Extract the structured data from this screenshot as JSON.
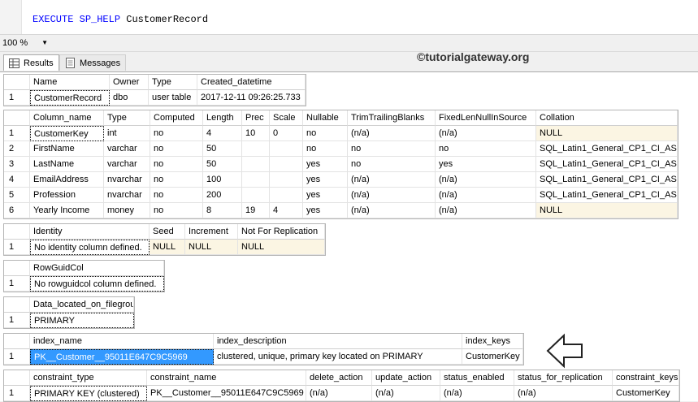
{
  "editor": {
    "kw1": "EXECUTE",
    "kw2": "SP_HELP",
    "table": "CustomerRecord"
  },
  "toolbar": {
    "zoom": "100 %"
  },
  "tabs": {
    "results": "Results",
    "messages": "Messages"
  },
  "watermark": "©tutorialgateway.org",
  "colors": {
    "keyword": "#0000ff",
    "selection": "#3399ff",
    "highlight": "#fbf5e3"
  },
  "grid1": {
    "headers": [
      "Name",
      "Owner",
      "Type",
      "Created_datetime"
    ],
    "rows": [
      [
        "1",
        "CustomerRecord",
        "dbo",
        "user table",
        "2017-12-11 09:26:25.733"
      ]
    ]
  },
  "grid2": {
    "headers": [
      "Column_name",
      "Type",
      "Computed",
      "Length",
      "Prec",
      "Scale",
      "Nullable",
      "TrimTrailingBlanks",
      "FixedLenNullInSource",
      "Collation"
    ],
    "rows": [
      [
        "1",
        "CustomerKey",
        "int",
        "no",
        "4",
        "10",
        "0",
        "no",
        "(n/a)",
        "(n/a)",
        "NULL"
      ],
      [
        "2",
        "FirstName",
        "varchar",
        "no",
        "50",
        "",
        "",
        "no",
        "no",
        "no",
        "SQL_Latin1_General_CP1_CI_AS"
      ],
      [
        "3",
        "LastName",
        "varchar",
        "no",
        "50",
        "",
        "",
        "yes",
        "no",
        "yes",
        "SQL_Latin1_General_CP1_CI_AS"
      ],
      [
        "4",
        "EmailAddress",
        "nvarchar",
        "no",
        "100",
        "",
        "",
        "yes",
        "(n/a)",
        "(n/a)",
        "SQL_Latin1_General_CP1_CI_AS"
      ],
      [
        "5",
        "Profession",
        "nvarchar",
        "no",
        "200",
        "",
        "",
        "yes",
        "(n/a)",
        "(n/a)",
        "SQL_Latin1_General_CP1_CI_AS"
      ],
      [
        "6",
        "Yearly Income",
        "money",
        "no",
        "8",
        "19",
        "4",
        "yes",
        "(n/a)",
        "(n/a)",
        "NULL"
      ]
    ]
  },
  "grid3": {
    "headers": [
      "Identity",
      "Seed",
      "Increment",
      "Not For Replication"
    ],
    "rows": [
      [
        "1",
        "No identity column defined.",
        "NULL",
        "NULL",
        "NULL"
      ]
    ]
  },
  "grid4": {
    "headers": [
      "RowGuidCol"
    ],
    "rows": [
      [
        "1",
        "No rowguidcol column defined."
      ]
    ]
  },
  "grid5": {
    "headers": [
      "Data_located_on_filegroup"
    ],
    "rows": [
      [
        "1",
        "PRIMARY"
      ]
    ]
  },
  "grid6": {
    "headers": [
      "index_name",
      "index_description",
      "index_keys"
    ],
    "rows": [
      [
        "1",
        "PK__Customer__95011E647C9C5969",
        "clustered, unique, primary key located on PRIMARY",
        "CustomerKey"
      ]
    ]
  },
  "grid7": {
    "headers": [
      "constraint_type",
      "constraint_name",
      "delete_action",
      "update_action",
      "status_enabled",
      "status_for_replication",
      "constraint_keys"
    ],
    "rows": [
      [
        "1",
        "PRIMARY KEY (clustered)",
        "PK__Customer__95011E647C9C5969",
        "(n/a)",
        "(n/a)",
        "(n/a)",
        "(n/a)",
        "CustomerKey"
      ]
    ]
  }
}
